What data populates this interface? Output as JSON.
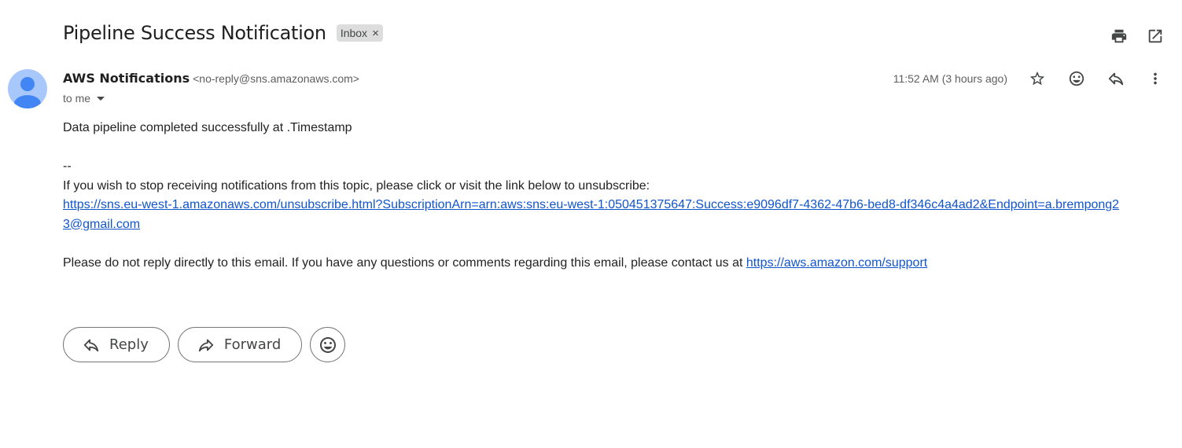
{
  "email": {
    "subject": "Pipeline Success Notification",
    "label": "Inbox",
    "label_remove": "×",
    "sender_name": "AWS Notifications",
    "sender_email": "<no-reply@sns.amazonaws.com>",
    "recipient": "to me",
    "timestamp": "11:52 AM (3 hours ago)"
  },
  "body": {
    "line1": "Data pipeline completed successfully at .Timestamp",
    "separator": "--",
    "unsubscribe_text": "If you wish to stop receiving notifications from this topic, please click or visit the link below to unsubscribe:",
    "unsubscribe_link": "https://sns.eu-west-1.amazonaws.com/unsubscribe.html?SubscriptionArn=arn:aws:sns:eu-west-1:050451375647:Success:e9096df7-4362-47b6-bed8-df346c4a4ad2&Endpoint=a.brempong23@gmail.com",
    "support_text": "Please do not reply directly to this email. If you have any questions or comments regarding this email, please contact us at ",
    "support_link": "https://aws.amazon.com/support"
  },
  "actions": {
    "reply_label": "Reply",
    "forward_label": "Forward"
  },
  "icons": {
    "print": "print-icon",
    "open_new_window": "open-in-new-icon",
    "star": "star-icon",
    "emoji": "emoji-icon",
    "reply": "reply-icon",
    "more": "more-vert-icon",
    "forward": "forward-icon"
  },
  "colors": {
    "link": "#1155cc",
    "avatar_bg": "#a8c7fa",
    "avatar_fg": "#4285f4",
    "label_chip": "#dddddd"
  }
}
